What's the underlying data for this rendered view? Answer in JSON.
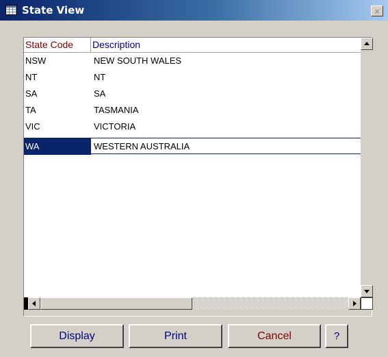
{
  "window": {
    "title": "State View",
    "close_glyph": "×"
  },
  "grid": {
    "columns": [
      "State Code",
      "Description"
    ],
    "rows": [
      {
        "code": "NSW",
        "description": "NEW SOUTH WALES"
      },
      {
        "code": "NT",
        "description": "NT"
      },
      {
        "code": "SA",
        "description": "SA"
      },
      {
        "code": "TA",
        "description": "TASMANIA"
      },
      {
        "code": "VIC",
        "description": "VICTORIA"
      },
      {
        "code": "WA",
        "description": "WESTERN AUSTRALIA"
      }
    ],
    "selected_row": 5
  },
  "buttons": {
    "display": "Display",
    "print": "Print",
    "cancel": "Cancel",
    "help": "?"
  },
  "icons": {
    "window": "table-icon",
    "close": "close-icon",
    "scroll_up": "arrow-up-icon",
    "scroll_down": "arrow-down-icon",
    "scroll_left": "arrow-left-icon",
    "scroll_right": "arrow-right-icon"
  },
  "colors": {
    "title_start": "#0a246a",
    "title_end": "#a6caf0",
    "selection": "#0a246a",
    "code_header": "#800000",
    "desc_header": "#000080"
  }
}
